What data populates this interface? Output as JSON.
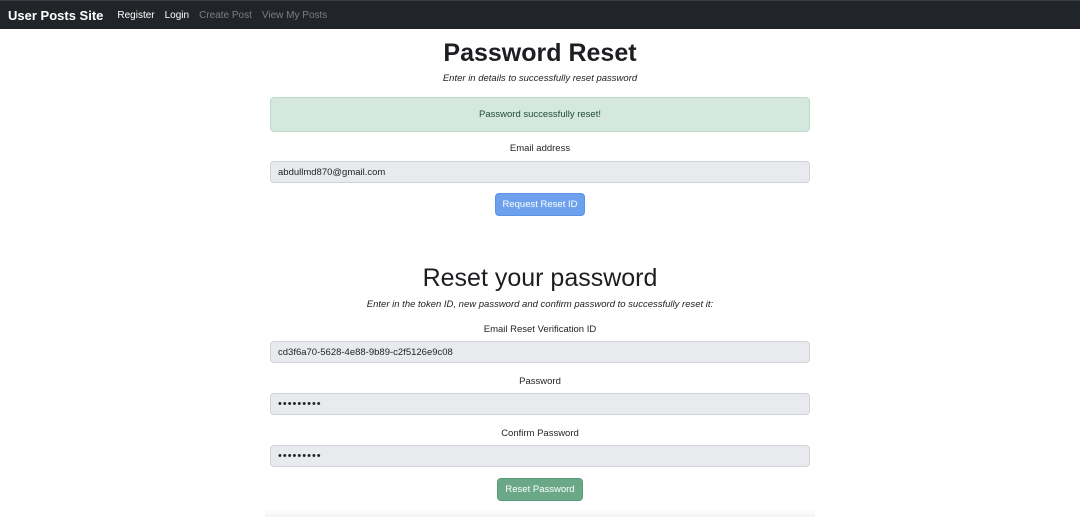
{
  "navbar": {
    "brand": "User Posts Site",
    "links": [
      {
        "label": "Register",
        "enabled": true
      },
      {
        "label": "Login",
        "enabled": true
      },
      {
        "label": "Create Post",
        "enabled": false
      },
      {
        "label": "View My Posts",
        "enabled": false
      }
    ]
  },
  "request_section": {
    "title": "Password Reset",
    "subtitle": "Enter in details to successfully reset password",
    "alert": "Password successfully reset!",
    "email_label": "Email address",
    "email_value": "abdullmd870@gmail.com",
    "button_label": "Request Reset ID"
  },
  "reset_section": {
    "title": "Reset your password",
    "subtitle": "Enter in the token ID, new password and confirm password to successfully reset it:",
    "token_label": "Email Reset Verification ID",
    "token_value": "cd3f6a70-5628-4e88-9b89-c2f5126e9c08",
    "password_label": "Password",
    "password_value": "password1",
    "confirm_label": "Confirm Password",
    "confirm_value": "password1",
    "button_label": "Reset Password"
  },
  "colors": {
    "navbar_bg": "#212529",
    "alert_bg": "#d4e8df",
    "primary_button": "#6da1ee",
    "success_button": "#6ba887"
  }
}
